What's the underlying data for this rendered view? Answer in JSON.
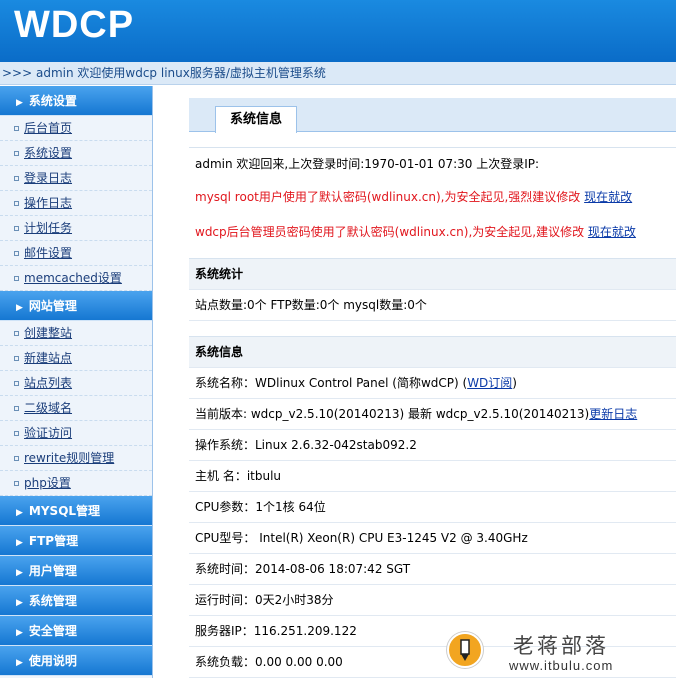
{
  "header": {
    "logo": "WDCP"
  },
  "breadcrumb": ">>> admin 欢迎使用wdcp linux服务器/虚拟主机管理系统",
  "sidebar": {
    "group1": {
      "title": "系统设置",
      "items": [
        "后台首页",
        "系统设置",
        "登录日志",
        "操作日志",
        "计划任务",
        "邮件设置",
        "memcached设置"
      ]
    },
    "group2": {
      "title": "网站管理",
      "items": [
        "创建整站",
        "新建站点",
        "站点列表",
        "二级域名",
        "验证访问",
        "rewrite规则管理",
        "php设置"
      ]
    },
    "collapsed": [
      "MYSQL管理",
      "FTP管理",
      "用户管理",
      "系统管理",
      "安全管理",
      "使用说明"
    ]
  },
  "main": {
    "tab": "系统信息",
    "welcome": "admin 欢迎回来,上次登录时间:1970-01-01 07:30 上次登录IP:",
    "warn1": "mysql root用户使用了默认密码(wdlinux.cn),为安全起见,强烈建议修改",
    "warn2": "wdcp后台管理员密码使用了默认密码(wdlinux.cn),为安全起见,建议修改",
    "fix_now": "现在就改",
    "stats_title": "系统统计",
    "stats": "站点数量:0个  FTP数量:0个  mysql数量:0个",
    "info_title": "系统信息",
    "sysname_prefix": "系统名称：WDlinux Control Panel (简称wdCP) (",
    "sysname_link": "WD订阅",
    "sysname_suffix": ")",
    "version_text": "当前版本: wdcp_v2.5.10(20140213) 最新 wdcp_v2.5.10(20140213)",
    "version_link": "更新日志",
    "os": "操作系统：Linux 2.6.32-042stab092.2",
    "host": "主机 名：itbulu",
    "cpu": "CPU参数：1个1核 64位",
    "cpu_model": "CPU型号： Intel(R) Xeon(R) CPU E3-1245 V2 @ 3.40GHz",
    "time": "系统时间：2014-08-06 18:07:42 SGT",
    "uptime": "运行时间：0天2小时38分",
    "ip": "服务器IP：116.251.209.122",
    "load": "系统负载：0.00   0.00   0.00"
  },
  "watermark": {
    "name": "老蒋部落",
    "url": "www.itbulu.com"
  }
}
